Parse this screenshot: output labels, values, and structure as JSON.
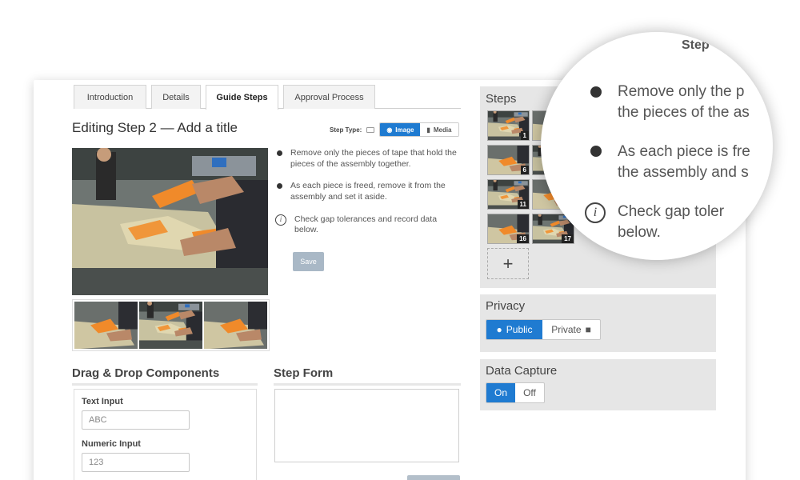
{
  "tabs": [
    "Introduction",
    "Details",
    "Guide Steps",
    "Approval Process"
  ],
  "editor": {
    "title": "Editing Step 2 — Add a title",
    "step_type_label": "Step Type:",
    "image_option": "Image",
    "media_option": "Media",
    "bullet_1": "Remove only the pieces of tape that hold the pieces of the assembly together.",
    "bullet_2": "As each piece is freed, remove it from the assembly and set it aside.",
    "note": "Check gap tolerances and record data below.",
    "save_label": "Save"
  },
  "drag_drop": {
    "heading": "Drag & Drop Components",
    "text_input_label": "Text Input",
    "text_input_placeholder": "ABC",
    "numeric_input_label": "Numeric Input",
    "numeric_input_placeholder": "123"
  },
  "step_form": {
    "heading": "Step Form"
  },
  "steps_panel": {
    "title": "Steps",
    "thumbs": [
      "1",
      "",
      "6",
      "",
      "11",
      "",
      "16",
      "17"
    ],
    "add_label": "+"
  },
  "privacy": {
    "title": "Privacy",
    "public_label": "Public",
    "private_label": "Private"
  },
  "data_capture": {
    "title": "Data Capture",
    "on_label": "On",
    "off_label": "Off"
  },
  "magnifier": {
    "step_label": "Step",
    "line_1a": "Remove only the p",
    "line_1b": "the pieces of the as",
    "line_2a": "As each piece is fre",
    "line_2b": "the assembly and s",
    "line_3a": "Check gap toler",
    "line_3b": "below."
  },
  "colors": {
    "accent": "#1f7bd1",
    "panel": "#e6e6e6",
    "save_disabled": "#a9b8c6"
  }
}
